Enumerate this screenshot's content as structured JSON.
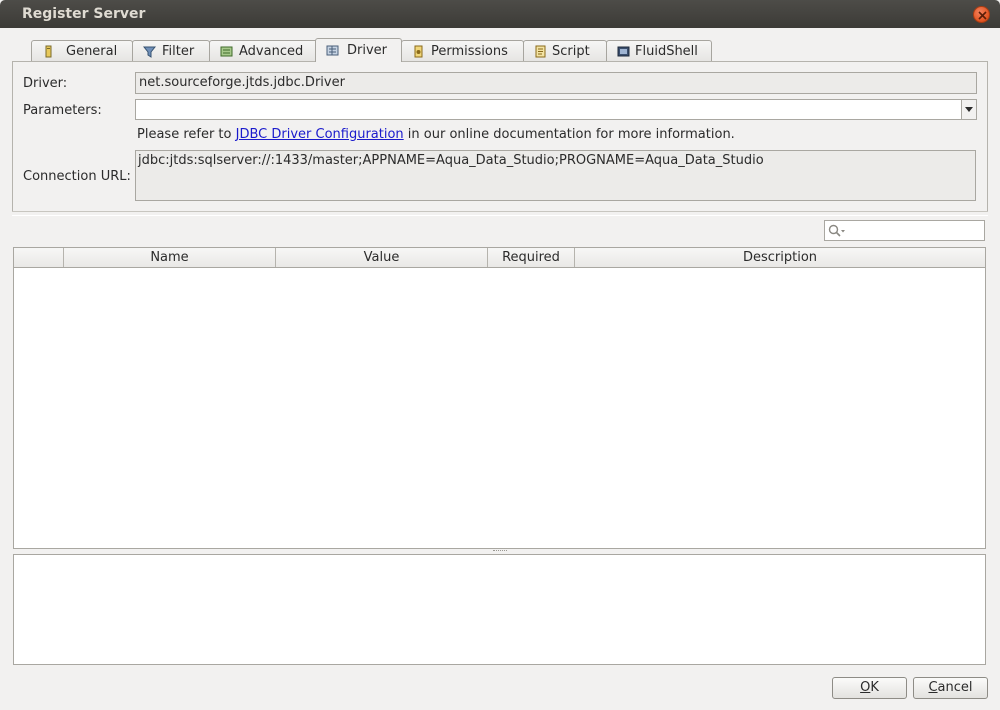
{
  "window": {
    "title": "Register Server"
  },
  "tabs": [
    {
      "label": "General",
      "icon": "general-icon"
    },
    {
      "label": "Filter",
      "icon": "filter-icon"
    },
    {
      "label": "Advanced",
      "icon": "advanced-icon"
    },
    {
      "label": "Driver",
      "icon": "driver-icon",
      "active": true
    },
    {
      "label": "Permissions",
      "icon": "permissions-icon"
    },
    {
      "label": "Script",
      "icon": "script-icon"
    },
    {
      "label": "FluidShell",
      "icon": "fluidshell-icon"
    }
  ],
  "driver": {
    "driver_label": "Driver:",
    "driver_value": "net.sourceforge.jtds.jdbc.Driver",
    "parameters_label": "Parameters:",
    "parameters_value": "",
    "info_prefix": "Please refer to ",
    "info_link": "JDBC Driver Configuration",
    "info_suffix": " in our online documentation for more information.",
    "url_label": "Connection URL:",
    "url_value": "jdbc:jtds:sqlserver://:1433/master;APPNAME=Aqua_Data_Studio;PROGNAME=Aqua_Data_Studio"
  },
  "search": {
    "placeholder": ""
  },
  "table": {
    "columns": [
      "",
      "Name",
      "Value",
      "Required",
      "Description"
    ],
    "rows": []
  },
  "buttons": {
    "ok_mnemonic": "O",
    "ok_rest": "K",
    "cancel_mnemonic": "C",
    "cancel_rest": "ancel"
  },
  "colors": {
    "titlebar": "#3c3b37",
    "close": "#e0521f",
    "link": "#1a1acc"
  }
}
